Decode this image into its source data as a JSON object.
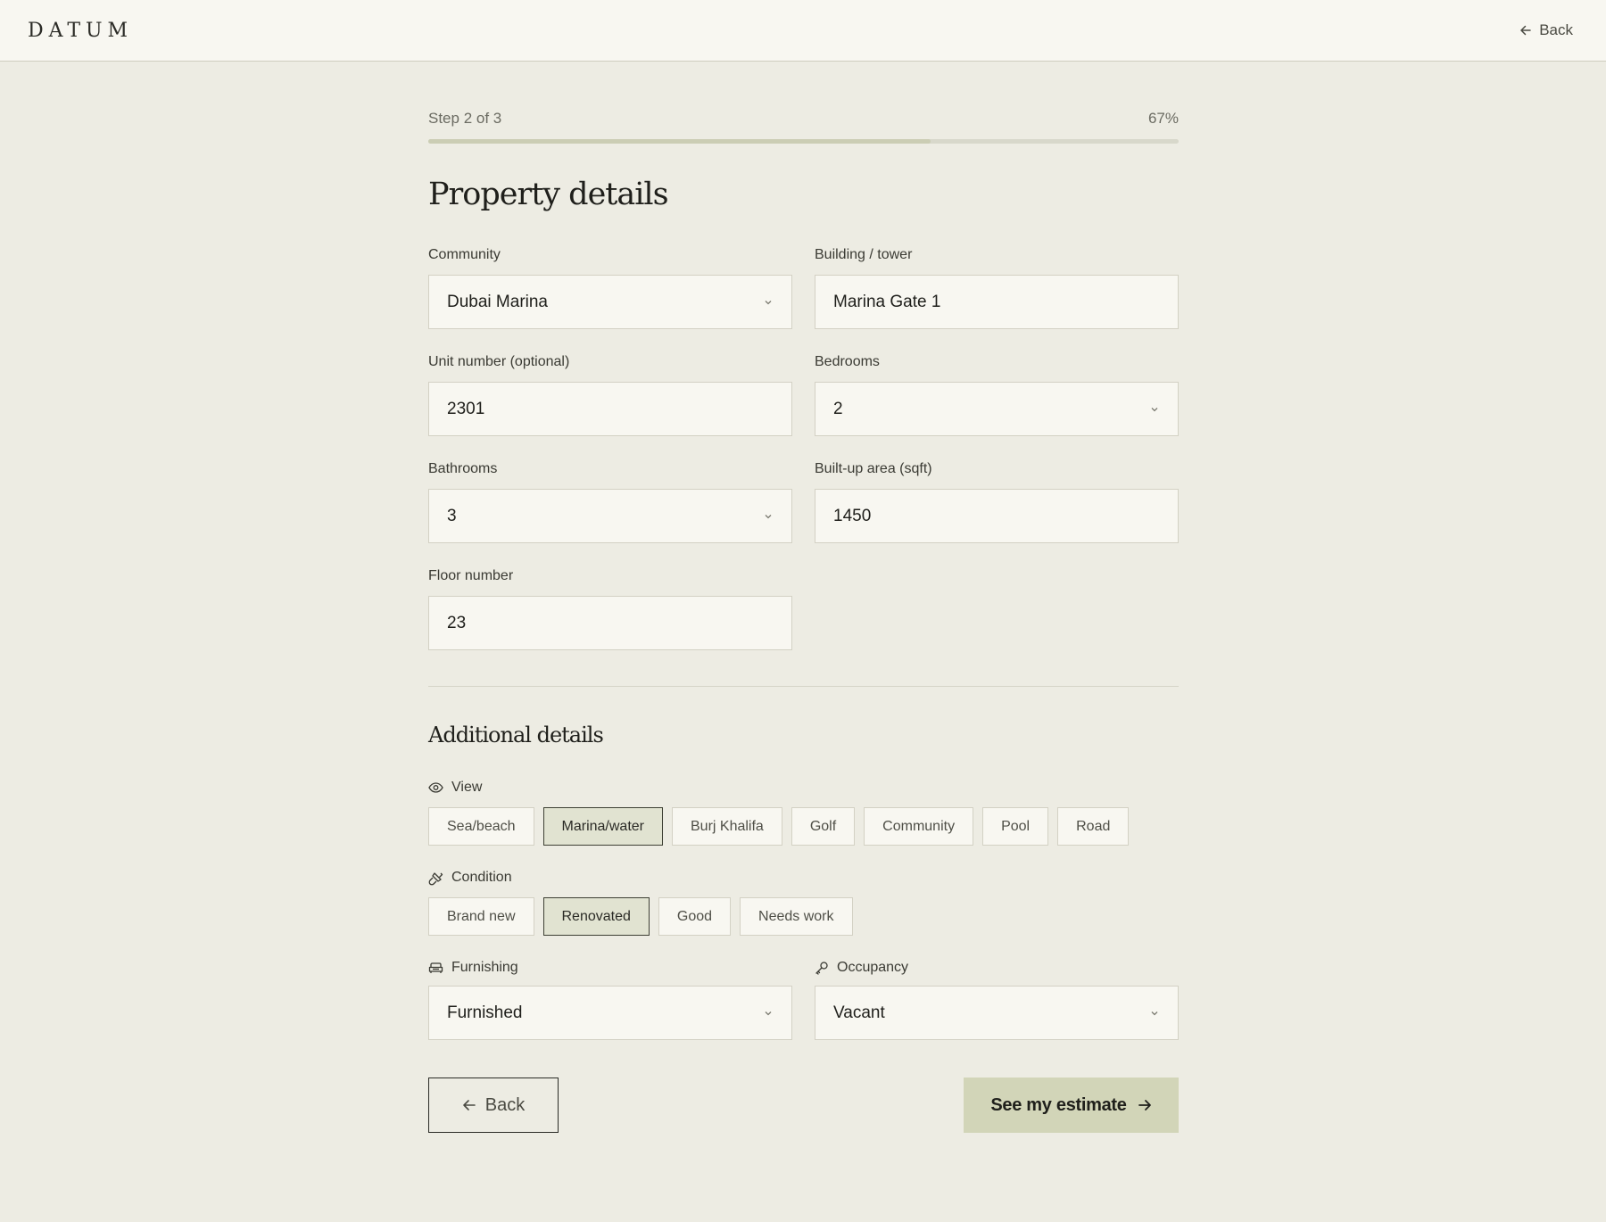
{
  "header": {
    "logo": "DATUM",
    "back_label": "Back"
  },
  "progress": {
    "step_text": "Step 2 of 3",
    "percent_text": "67%",
    "fraction": 0.67
  },
  "title": "Property details",
  "fields": {
    "community": {
      "label": "Community",
      "value": "Dubai Marina"
    },
    "building": {
      "label": "Building / tower",
      "value": "Marina Gate 1"
    },
    "unit": {
      "label": "Unit number (optional)",
      "value": "2301"
    },
    "bedrooms": {
      "label": "Bedrooms",
      "value": "2"
    },
    "bathrooms": {
      "label": "Bathrooms",
      "value": "3"
    },
    "area": {
      "label": "Built-up area (sqft)",
      "value": "1450"
    },
    "floor": {
      "label": "Floor number",
      "value": "23"
    }
  },
  "additional": {
    "title": "Additional details",
    "view": {
      "label": "View",
      "options": [
        "Sea/beach",
        "Marina/water",
        "Burj Khalifa",
        "Golf",
        "Community",
        "Pool",
        "Road"
      ],
      "selected": "Marina/water"
    },
    "condition": {
      "label": "Condition",
      "options": [
        "Brand new",
        "Renovated",
        "Good",
        "Needs work"
      ],
      "selected": "Renovated"
    },
    "furnishing": {
      "label": "Furnishing",
      "value": "Furnished"
    },
    "occupancy": {
      "label": "Occupancy",
      "value": "Vacant"
    }
  },
  "actions": {
    "back_label": "Back",
    "submit_label": "See my estimate"
  },
  "colors": {
    "background": "#edece3",
    "accent": "#d2d5b8",
    "selected_chip": "#e1e3d1"
  }
}
